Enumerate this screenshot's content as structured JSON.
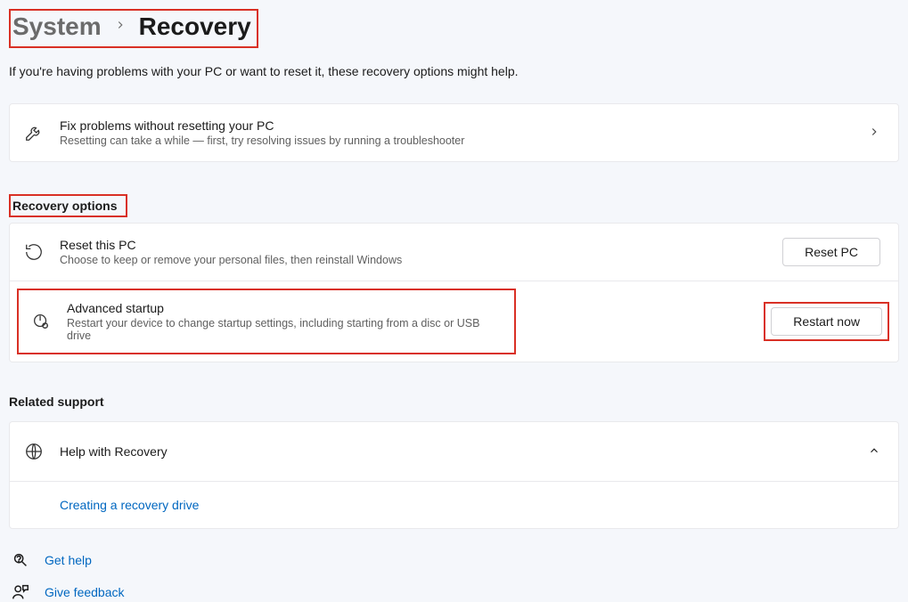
{
  "breadcrumb": {
    "parent": "System",
    "current": "Recovery"
  },
  "intro": "If you're having problems with your PC or want to reset it, these recovery options might help.",
  "fix": {
    "title": "Fix problems without resetting your PC",
    "sub": "Resetting can take a while — first, try resolving issues by running a troubleshooter"
  },
  "sections": {
    "recovery_options": "Recovery options",
    "related_support": "Related support"
  },
  "reset": {
    "title": "Reset this PC",
    "sub": "Choose to keep or remove your personal files, then reinstall Windows",
    "button": "Reset PC"
  },
  "advanced": {
    "title": "Advanced startup",
    "sub": "Restart your device to change startup settings, including starting from a disc or USB drive",
    "button": "Restart now"
  },
  "help": {
    "title": "Help with Recovery",
    "link": "Creating a recovery drive"
  },
  "footer": {
    "get_help": "Get help",
    "give_feedback": "Give feedback"
  }
}
